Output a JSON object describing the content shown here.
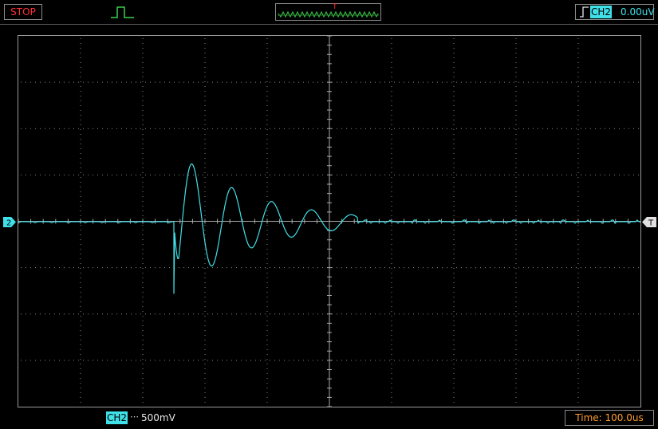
{
  "status": {
    "run_state": "STOP"
  },
  "trigger": {
    "marker_label": "T",
    "source": "CH2",
    "level": "0.00uV"
  },
  "channel": {
    "marker": "2",
    "name": "CH2",
    "scale": "500mV"
  },
  "timebase": {
    "label": "Time: 100.0us"
  },
  "colors": {
    "trace": "#40e0e8",
    "stop": "#ff3030",
    "time": "#ff9d2e",
    "trigger_marker": "#e0e0e0"
  }
}
